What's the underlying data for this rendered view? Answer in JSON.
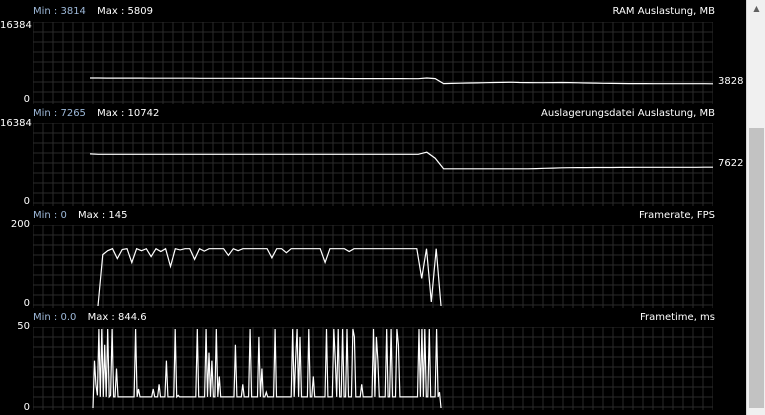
{
  "panels": [
    {
      "min_label": "Min : 3814",
      "max_label": "Max : 5809",
      "title": "RAM Auslastung, MB",
      "y_top": "16384",
      "y_bottom": "0",
      "current": "3828",
      "series": [
        5050,
        5050,
        5030,
        5020,
        5020,
        5010,
        5010,
        5000,
        5000,
        5000,
        4990,
        4990,
        4990,
        4980,
        4980,
        4980,
        4970,
        4970,
        4960,
        4960,
        4960,
        4950,
        4950,
        4950,
        4950,
        4940,
        4940,
        4940,
        4930,
        4930,
        4930,
        4920,
        4920,
        4920,
        4920,
        4910,
        4910,
        4910,
        4900,
        4900,
        5050,
        4920,
        3860,
        3900,
        3950,
        4000,
        4020,
        4060,
        4100,
        4120,
        4150,
        4100,
        4080,
        4060,
        4050,
        4080,
        4100,
        4080,
        4040,
        4000,
        3960,
        3920,
        3900,
        3880,
        3870,
        3860,
        3860,
        3850,
        3850,
        3850,
        3840,
        3840,
        3840,
        3840,
        3830
      ]
    },
    {
      "min_label": "Min : 7265",
      "max_label": "Max : 10742",
      "title": "Auslagerungsdatei Auslastung, MB",
      "y_top": "16384",
      "y_bottom": "0",
      "current": "7622",
      "series": [
        10400,
        10300,
        10300,
        10300,
        10300,
        10300,
        10300,
        10300,
        10300,
        10300,
        10300,
        10300,
        10300,
        10300,
        10300,
        10300,
        10300,
        10300,
        10300,
        10300,
        10300,
        10300,
        10300,
        10300,
        10300,
        10300,
        10300,
        10300,
        10300,
        10300,
        10300,
        10300,
        10300,
        10300,
        10300,
        10300,
        10300,
        10300,
        10300,
        10300,
        10742,
        9500,
        7300,
        7300,
        7300,
        7300,
        7300,
        7300,
        7300,
        7300,
        7300,
        7300,
        7300,
        7350,
        7400,
        7450,
        7500,
        7520,
        7550,
        7550,
        7560,
        7570,
        7580,
        7590,
        7600,
        7610,
        7610,
        7620,
        7620,
        7620,
        7620,
        7620,
        7620,
        7622,
        7622
      ]
    },
    {
      "min_label": "Min : 0",
      "max_label": "Max : 145",
      "title": "Framerate, FPS",
      "y_top": "200",
      "y_bottom": "0",
      "current": "",
      "series": [
        0,
        130,
        140,
        145,
        120,
        143,
        145,
        110,
        145,
        140,
        145,
        125,
        145,
        138,
        145,
        100,
        145,
        142,
        145,
        145,
        118,
        145,
        139,
        145,
        145,
        145,
        145,
        128,
        145,
        140,
        145,
        145,
        145,
        145,
        145,
        145,
        122,
        145,
        145,
        135,
        145,
        145,
        145,
        145,
        145,
        145,
        145,
        110,
        145,
        145,
        145,
        145,
        138,
        145,
        145,
        145,
        145,
        145,
        145,
        145,
        145,
        145,
        145,
        145,
        145,
        145,
        145,
        70,
        145,
        10,
        145,
        0
      ]
    },
    {
      "min_label": "Min : 0.0",
      "max_label": "Max : 844.6",
      "title": "Frametime, ms",
      "y_top": "50",
      "y_bottom": "0",
      "current": "",
      "series": [
        0,
        30,
        15,
        8,
        50,
        7,
        50,
        7,
        40,
        7,
        50,
        7,
        8,
        50,
        7,
        7,
        25,
        7,
        7,
        7,
        7,
        7,
        7,
        7,
        7,
        7,
        7,
        7,
        7,
        50,
        7,
        12,
        7,
        7,
        7,
        7,
        7,
        7,
        7,
        7,
        7,
        12,
        7,
        7,
        7,
        15,
        7,
        7,
        7,
        7,
        30,
        7,
        7,
        7,
        7,
        7,
        50,
        7,
        8,
        7,
        7,
        7,
        7,
        7,
        7,
        7,
        7,
        7,
        7,
        7,
        7,
        50,
        7,
        7,
        7,
        7,
        7,
        50,
        7,
        35,
        7,
        30,
        7,
        7,
        50,
        7,
        20,
        7,
        7,
        7,
        7,
        7,
        7,
        7,
        7,
        7,
        7,
        40,
        7,
        7,
        7,
        7,
        15,
        7,
        7,
        7,
        7,
        50,
        7,
        7,
        7,
        7,
        7,
        45,
        7,
        25,
        7,
        7,
        10,
        7,
        7,
        7,
        7,
        7,
        50,
        7,
        7,
        7,
        7,
        7,
        7,
        7,
        7,
        7,
        7,
        7,
        50,
        7,
        30,
        50,
        7,
        45,
        7,
        7,
        7,
        7,
        7,
        50,
        7,
        7,
        20,
        7,
        7,
        7,
        7,
        7,
        7,
        7,
        7,
        50,
        7,
        7,
        7,
        7,
        50,
        30,
        7,
        50,
        7,
        7,
        50,
        7,
        7,
        50,
        7,
        7,
        7,
        50,
        45,
        7,
        7,
        7,
        7,
        15,
        7,
        7,
        7,
        7,
        7,
        7,
        7,
        50,
        7,
        45,
        30,
        7,
        7,
        7,
        7,
        7,
        50,
        7,
        7,
        50,
        7,
        7,
        7,
        50,
        40,
        7,
        7,
        7,
        7,
        7,
        7,
        7,
        7,
        7,
        7,
        7,
        7,
        7,
        50,
        7,
        50,
        7,
        50,
        7,
        7,
        50,
        7,
        7,
        7,
        7,
        50,
        7,
        10,
        0
      ]
    }
  ]
}
